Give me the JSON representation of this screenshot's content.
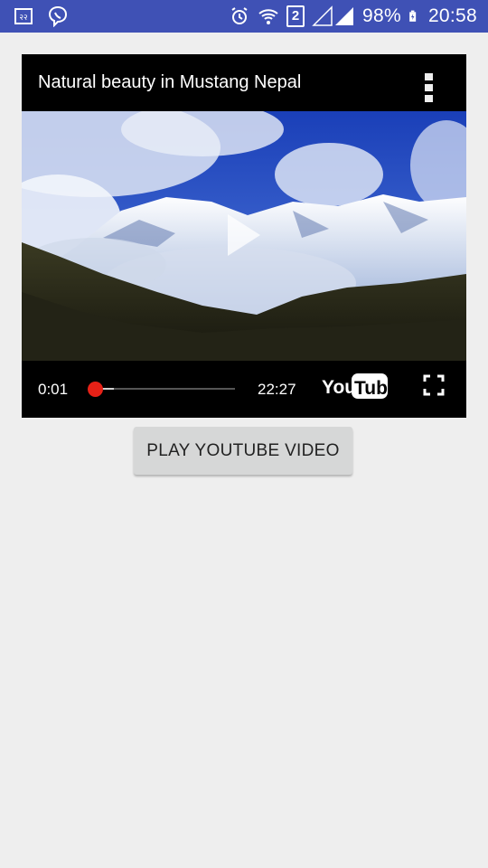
{
  "status_bar": {
    "battery": "98%",
    "time": "20:58",
    "sim_badge": "2",
    "icons": [
      "gallery-icon",
      "viber-icon",
      "alarm-icon",
      "wifi-icon",
      "signal-icon",
      "battery-charging-icon"
    ],
    "background_color": "#3f51b5"
  },
  "player": {
    "title": "Natural beauty in Mustang Nepal",
    "current_time": "0:01",
    "total_time": "22:27",
    "progress": 0.001,
    "logo_text_you": "You",
    "logo_text_tube": "Tube",
    "accent_color": "#e62117"
  },
  "actions": {
    "play_button_label": "PLAY YOUTUBE VIDEO"
  }
}
